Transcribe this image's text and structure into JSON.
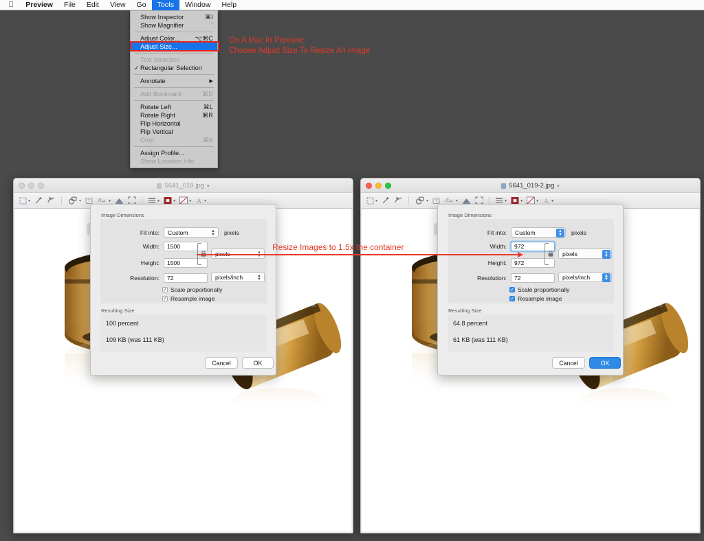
{
  "menubar": {
    "apple_icon": "apple-logo",
    "items": [
      {
        "label": "Preview",
        "bold": true,
        "active": false
      },
      {
        "label": "File",
        "bold": false,
        "active": false
      },
      {
        "label": "Edit",
        "bold": false,
        "active": false
      },
      {
        "label": "View",
        "bold": false,
        "active": false
      },
      {
        "label": "Go",
        "bold": false,
        "active": false
      },
      {
        "label": "Tools",
        "bold": false,
        "active": true
      },
      {
        "label": "Window",
        "bold": false,
        "active": false
      },
      {
        "label": "Help",
        "bold": false,
        "active": false
      }
    ],
    "active_color": "#1673e8"
  },
  "tools_menu": {
    "items": [
      {
        "label": "Show Inspector",
        "shortcut": "⌘I",
        "state": "normal",
        "kind": "item"
      },
      {
        "label": "Show Magnifier",
        "shortcut": "`",
        "state": "normal",
        "kind": "item"
      },
      {
        "label": "",
        "shortcut": "",
        "state": "normal",
        "kind": "sep"
      },
      {
        "label": "Adjust Color...",
        "shortcut": "⌥⌘C",
        "state": "normal",
        "kind": "item"
      },
      {
        "label": "Adjust Size...",
        "shortcut": "",
        "state": "selected",
        "kind": "item"
      },
      {
        "label": "",
        "shortcut": "",
        "state": "normal",
        "kind": "sep"
      },
      {
        "label": "Text Selection",
        "shortcut": "",
        "state": "disabled",
        "kind": "item"
      },
      {
        "label": "Rectangular Selection",
        "shortcut": "",
        "state": "checked",
        "kind": "item"
      },
      {
        "label": "",
        "shortcut": "",
        "state": "normal",
        "kind": "sep"
      },
      {
        "label": "Annotate",
        "shortcut": "▶",
        "state": "submenu",
        "kind": "item"
      },
      {
        "label": "",
        "shortcut": "",
        "state": "normal",
        "kind": "sep"
      },
      {
        "label": "Add Bookmark",
        "shortcut": "⌘D",
        "state": "disabled",
        "kind": "item"
      },
      {
        "label": "",
        "shortcut": "",
        "state": "normal",
        "kind": "sep"
      },
      {
        "label": "Rotate Left",
        "shortcut": "⌘L",
        "state": "normal",
        "kind": "item"
      },
      {
        "label": "Rotate Right",
        "shortcut": "⌘R",
        "state": "normal",
        "kind": "item"
      },
      {
        "label": "Flip Horizontal",
        "shortcut": "",
        "state": "normal",
        "kind": "item"
      },
      {
        "label": "Flip Vertical",
        "shortcut": "",
        "state": "normal",
        "kind": "item"
      },
      {
        "label": "Crop",
        "shortcut": "⌘K",
        "state": "disabled",
        "kind": "item"
      },
      {
        "label": "",
        "shortcut": "",
        "state": "normal",
        "kind": "sep"
      },
      {
        "label": "Assign Profile...",
        "shortcut": "",
        "state": "normal",
        "kind": "item"
      },
      {
        "label": "Show Location Info",
        "shortcut": "",
        "state": "disabled",
        "kind": "item"
      }
    ],
    "highlight_color": "#e8241b"
  },
  "annotations": {
    "top_line1": "On A Mac In Preview:",
    "top_line2": "Choose Adjust Size To Resize An Image",
    "middle": "Resize Images to 1.5x the container",
    "color": "#e03a28"
  },
  "windows": [
    {
      "id": "left",
      "title": "5641_019.jpg",
      "focused": false,
      "traffic_lights": [
        "close-button",
        "minimize-button",
        "zoom-button"
      ],
      "toolbar_icons": [
        "rectangular-selection-icon",
        "chevron-down-icon",
        "instant-alpha-icon",
        "sketch-icon",
        "shapes-icon",
        "chevron-down-icon",
        "text-icon",
        "sign-icon",
        "chevron-down-icon",
        "adjust-color-icon",
        "adjust-size-icon",
        "line-style-icon",
        "chevron-down-icon",
        "border-color-icon",
        "chevron-down-icon",
        "fill-color-icon",
        "chevron-down-icon",
        "font-icon",
        "chevron-down-icon"
      ]
    },
    {
      "id": "right",
      "title": "5641_019-2.jpg",
      "focused": true,
      "traffic_lights": [
        "close-button",
        "minimize-button",
        "zoom-button"
      ],
      "toolbar_icons": [
        "rectangular-selection-icon",
        "chevron-down-icon",
        "instant-alpha-icon",
        "sketch-icon",
        "shapes-icon",
        "chevron-down-icon",
        "text-icon",
        "sign-icon",
        "chevron-down-icon",
        "adjust-color-icon",
        "adjust-size-icon",
        "line-style-icon",
        "chevron-down-icon",
        "border-color-icon",
        "chevron-down-icon",
        "fill-color-icon",
        "chevron-down-icon",
        "font-icon",
        "chevron-down-icon"
      ]
    }
  ],
  "dialogs": [
    {
      "id": "left",
      "group_title": "Image Dimensions",
      "fit_into_label": "Fit into:",
      "fit_into_value": "Custom",
      "fit_into_unit": "pixels",
      "width_label": "Width:",
      "width_value": "1500",
      "height_label": "Height:",
      "height_value": "1500",
      "dimension_unit": "pixels",
      "resolution_label": "Resolution:",
      "resolution_value": "72",
      "resolution_unit": "pixels/inch",
      "scale_proportionally_label": "Scale proportionally",
      "scale_proportionally_checked": true,
      "resample_image_label": "Resample image",
      "resample_image_checked": true,
      "resulting_size_title": "Resulting Size",
      "percent_text": "100 percent",
      "size_text": "109 KB (was 111 KB)",
      "cancel_label": "Cancel",
      "ok_label": "OK",
      "ok_primary": false,
      "width_focused": false,
      "controls_tinted": false
    },
    {
      "id": "right",
      "group_title": "Image Dimensions",
      "fit_into_label": "Fit into:",
      "fit_into_value": "Custom",
      "fit_into_unit": "pixels",
      "width_label": "Width:",
      "width_value": "972",
      "height_label": "Height:",
      "height_value": "972",
      "dimension_unit": "pixels",
      "resolution_label": "Resolution:",
      "resolution_value": "72",
      "resolution_unit": "pixels/inch",
      "scale_proportionally_label": "Scale proportionally",
      "scale_proportionally_checked": true,
      "resample_image_label": "Resample image",
      "resample_image_checked": true,
      "resulting_size_title": "Resulting Size",
      "percent_text": "64.8 percent",
      "size_text": "61 KB (was 111 KB)",
      "cancel_label": "Cancel",
      "ok_label": "OK",
      "ok_primary": true,
      "width_focused": true,
      "controls_tinted": true
    }
  ],
  "colors": {
    "desktop": "#4a4a4a",
    "menu_highlight": "#1673e8",
    "annotation_red": "#e03a28",
    "primary_button": "#2e8ae6",
    "jar_gold": "#d8a24a"
  }
}
